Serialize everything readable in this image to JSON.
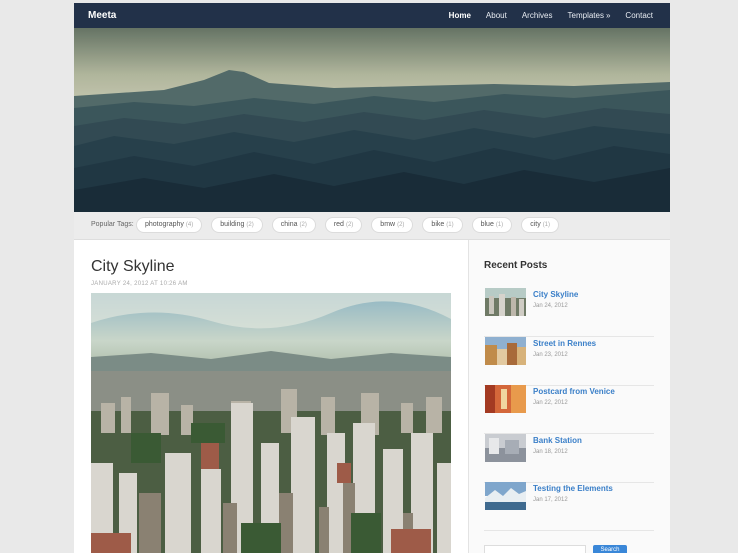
{
  "nav": {
    "brand": "Meeta",
    "items": [
      {
        "label": "Home",
        "active": true
      },
      {
        "label": "About",
        "active": false
      },
      {
        "label": "Archives",
        "active": false
      },
      {
        "label": "Templates",
        "has_submenu": true
      },
      {
        "label": "Contact",
        "active": false
      }
    ],
    "submenu_glyph": "»"
  },
  "tags": {
    "label": "Popular Tags:",
    "items": [
      {
        "name": "photography",
        "count": "(4)"
      },
      {
        "name": "building",
        "count": "(2)"
      },
      {
        "name": "china",
        "count": "(2)"
      },
      {
        "name": "red",
        "count": "(2)"
      },
      {
        "name": "bmw",
        "count": "(2)"
      },
      {
        "name": "bike",
        "count": "(1)"
      },
      {
        "name": "blue",
        "count": "(1)"
      },
      {
        "name": "city",
        "count": "(1)"
      }
    ]
  },
  "post": {
    "title": "City Skyline",
    "date": "JANUARY 24, 2012 AT 10:26 AM"
  },
  "sidebar": {
    "title": "Recent Posts",
    "posts": [
      {
        "title": "City Skyline",
        "date": "Jan 24, 2012"
      },
      {
        "title": "Street in Rennes",
        "date": "Jan 23, 2012"
      },
      {
        "title": "Postcard from Venice",
        "date": "Jan 22, 2012"
      },
      {
        "title": "Bank Station",
        "date": "Jan 18, 2012"
      },
      {
        "title": "Testing the Elements",
        "date": "Jan 17, 2012"
      }
    ],
    "search_button": "Search"
  },
  "colors": {
    "nav_bg": "#223149",
    "link": "#3a7fc8",
    "search_button": "#3a87d8"
  }
}
